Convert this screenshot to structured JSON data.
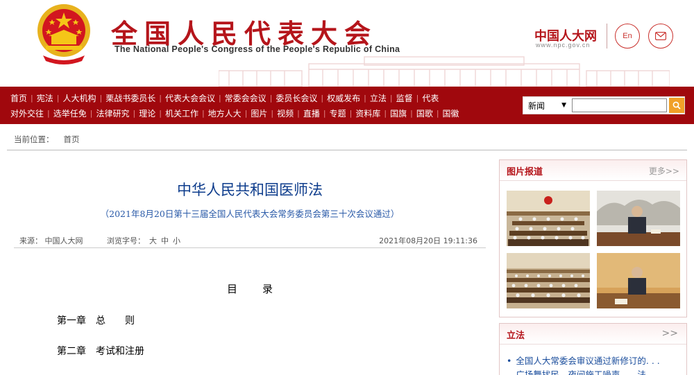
{
  "header": {
    "title": "全国人民代表大会",
    "subtitle": "The National People's Congress of the People's Republic of China",
    "logo_text": "中国人大网",
    "logo_url": "www.npc.gov.cn",
    "lang_label": "En"
  },
  "nav": {
    "row1": [
      "首页",
      "宪法",
      "人大机构",
      "栗战书委员长",
      "代表大会会议",
      "常委会会议",
      "委员长会议",
      "权威发布",
      "立法",
      "监督",
      "代表"
    ],
    "row2": [
      "对外交往",
      "选举任免",
      "法律研究",
      "理论",
      "机关工作",
      "地方人大",
      "图片",
      "视频",
      "直播",
      "专题",
      "资料库",
      "国旗",
      "国歌",
      "国徽"
    ]
  },
  "search": {
    "select_label": "新闻",
    "input_value": ""
  },
  "breadcrumb": {
    "label": "当前位置：",
    "items": [
      "首页"
    ]
  },
  "article": {
    "title": "中华人民共和国医师法",
    "subtitle": "（2021年8月20日第十三届全国人民代表大会常务委员会第三十次会议通过）",
    "source": "来源：  中国人大网",
    "font_label": "浏览字号：",
    "font_sizes": [
      "大",
      "中",
      "小"
    ],
    "date": "2021年08月20日  19:11:36",
    "toc_title": "目录",
    "toc": [
      "第一章　总　　则",
      "第二章　考试和注册"
    ]
  },
  "sidebar": {
    "photo_panel": {
      "title": "图片报道",
      "more": "更多>>"
    },
    "law_panel": {
      "title": "立法",
      "more": ">>",
      "items": [
        "全国人大常委会审议通过新修订的. . .",
        "广场舞扰民、夜间施工噪声……法"
      ]
    }
  }
}
